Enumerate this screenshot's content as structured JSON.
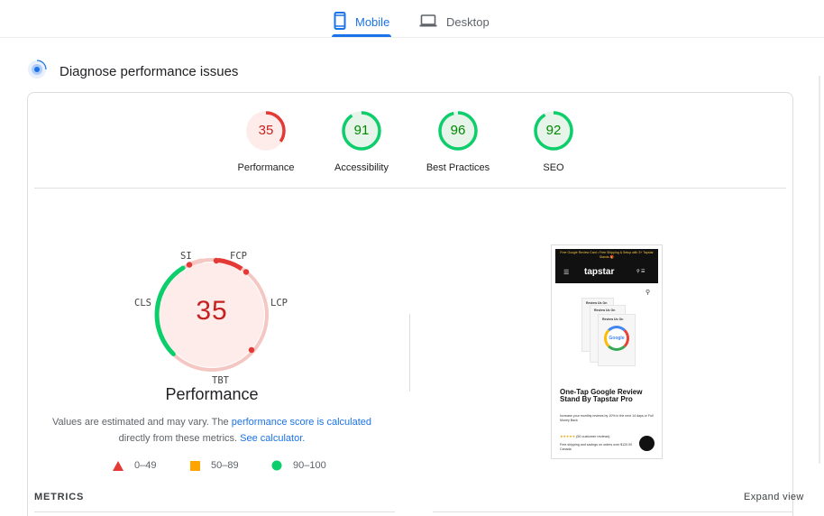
{
  "tabs": [
    {
      "label": "Mobile",
      "icon": "smartphone-icon",
      "active": true
    },
    {
      "label": "Desktop",
      "icon": "laptop-icon",
      "active": false
    }
  ],
  "diagnose": {
    "title": "Diagnose performance issues"
  },
  "scores": [
    {
      "label": "Performance",
      "value": "35",
      "fraction": 0.35,
      "color": "#e53935",
      "bg": "#fdecea"
    },
    {
      "label": "Accessibility",
      "value": "91",
      "fraction": 0.91,
      "color": "#0cce6b",
      "bg": "#e6f4ea"
    },
    {
      "label": "Best Practices",
      "value": "96",
      "fraction": 0.96,
      "color": "#0cce6b",
      "bg": "#e6f4ea"
    },
    {
      "label": "SEO",
      "value": "92",
      "fraction": 0.92,
      "color": "#0cce6b",
      "bg": "#e6f4ea"
    }
  ],
  "performance": {
    "score": "35",
    "title": "Performance",
    "metric_labels": {
      "si": "SI",
      "fcp": "FCP",
      "lcp": "LCP",
      "tbt": "TBT",
      "cls": "CLS"
    },
    "note_prefix": "Values are estimated and may vary. The ",
    "note_link1": "performance score is calculated",
    "note_middle": "directly from these metrics. ",
    "note_link2": "See calculator."
  },
  "legend": [
    {
      "shape": "triangle",
      "label": "0–49",
      "color": "#e53935"
    },
    {
      "shape": "square",
      "label": "50–89",
      "color": "#ffa400"
    },
    {
      "shape": "circle",
      "label": "90–100",
      "color": "#0cce6b"
    }
  ],
  "thumbnail": {
    "banner": "Free Google Review Card • Free Shipping & Setup with 3+ Tapstar Stands 🎁",
    "logo": "tapstar",
    "card_labels": [
      "Review Us On",
      "Review Us On",
      "Review Us On"
    ],
    "google_text": "Google",
    "title": "One-Tap Google Review Stand By Tapstar Pro",
    "subtitle": "Increase your monthly reviews by 10% in the next 14 days or Full Money Back",
    "stars": "★★★★★",
    "reviews": "(50 customer reviews)",
    "footer": "Free shipping and savings on orders over $120.00 Canada"
  },
  "metrics": {
    "title": "METRICS",
    "expand_label": "Expand view"
  }
}
